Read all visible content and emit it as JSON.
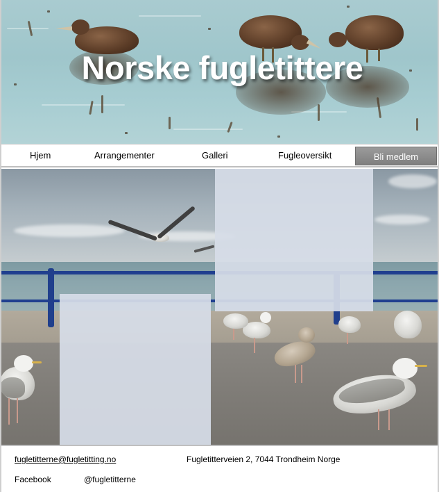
{
  "header": {
    "title": "Norske fugletittere"
  },
  "nav": {
    "items": [
      {
        "label": "Hjem"
      },
      {
        "label": "Arrangementer"
      },
      {
        "label": "Galleri"
      },
      {
        "label": "Fugleoversikt"
      }
    ],
    "cta_label": "Bli medlem"
  },
  "footer": {
    "email": "fugletitterne@fugletitting.no",
    "address": "Fugletitterveien 2, 7044 Trondheim Norge",
    "social_label": "Facebook",
    "social_handle": "@fugletitterne"
  },
  "colors": {
    "cta_background": "#8c8c8c",
    "panel_background": "#d6dde7",
    "title_text": "#ffffff"
  }
}
